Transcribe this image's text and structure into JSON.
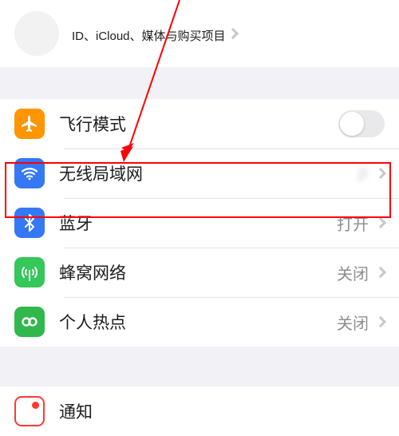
{
  "profile": {
    "name_masked": "",
    "subtitle": "ID、iCloud、媒体与购买项目"
  },
  "rows": {
    "airplane": {
      "label": "飞行模式"
    },
    "wifi": {
      "label": "无线局域网",
      "value_masked": "        ji"
    },
    "bluetooth": {
      "label": "蓝牙",
      "value": "打开"
    },
    "cellular": {
      "label": "蜂窝网络",
      "value": "关闭"
    },
    "hotspot": {
      "label": "个人热点",
      "value": "关闭"
    },
    "notify": {
      "label": "通知"
    }
  }
}
